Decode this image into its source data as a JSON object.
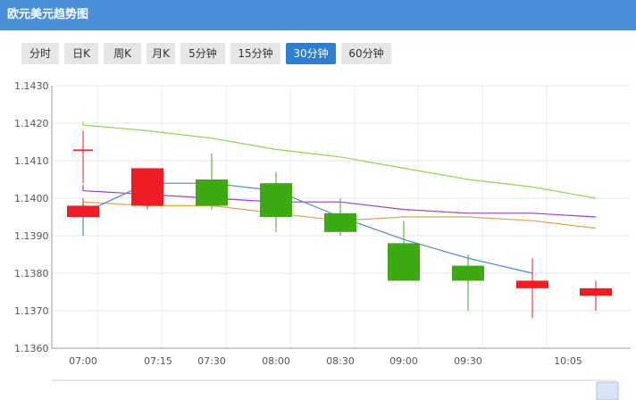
{
  "header": {
    "title": "欧元美元趋势图"
  },
  "tabs": [
    {
      "label": "分时",
      "active": false
    },
    {
      "label": "日K",
      "active": false
    },
    {
      "label": "周K",
      "active": false
    },
    {
      "label": "月K",
      "active": false
    },
    {
      "label": "5分钟",
      "active": false
    },
    {
      "label": "15分钟",
      "active": false
    },
    {
      "label": "30分钟",
      "active": true
    },
    {
      "label": "60分钟",
      "active": false
    }
  ],
  "colors": {
    "header": "#4a90d9",
    "up": "#ee1c25",
    "down": "#3daa14",
    "ma_blue": "#4a86d8",
    "ma_green": "#8fd44a",
    "ma_purple": "#9a3ed0",
    "ma_orange": "#e0a04a"
  },
  "chart_data": {
    "type": "candlestick",
    "ylim": [
      1.136,
      1.143
    ],
    "y_ticks": [
      "1.1430",
      "1.1420",
      "1.1410",
      "1.1400",
      "1.1390",
      "1.1380",
      "1.1370",
      "1.1360"
    ],
    "x_labels": [
      "07:00",
      "07:15",
      "07:30",
      "08:00",
      "08:30",
      "09:00",
      "09:30",
      "10:05"
    ],
    "candles": [
      {
        "open": 1.1398,
        "close": 1.1395,
        "high": 1.14,
        "low": 1.1395
      },
      {
        "open": 1.1413,
        "close": 1.1413,
        "high": 1.1418,
        "low": 1.1404
      },
      {
        "open": 1.1408,
        "close": 1.1398,
        "high": 1.1408,
        "low": 1.1397
      },
      {
        "open": 1.1405,
        "close": 1.1398,
        "high": 1.1412,
        "low": 1.1397
      },
      {
        "open": 1.1404,
        "close": 1.1395,
        "high": 1.1407,
        "low": 1.1391
      },
      {
        "open": 1.1396,
        "close": 1.1391,
        "high": 1.14,
        "low": 1.139
      },
      {
        "open": 1.1388,
        "close": 1.1378,
        "high": 1.1394,
        "low": 1.1378
      },
      {
        "open": 1.1382,
        "close": 1.1378,
        "high": 1.1385,
        "low": 1.137
      },
      {
        "open": 1.1378,
        "close": 1.1376,
        "high": 1.1384,
        "low": 1.1368
      },
      {
        "open": 1.1376,
        "close": 1.1374,
        "high": 1.1378,
        "low": 1.137
      }
    ],
    "ma_series": [
      {
        "color": "ma_green",
        "values": [
          1.14205,
          1.14195,
          1.1418,
          1.1416,
          1.1413,
          1.1411,
          1.1408,
          1.1405,
          1.1403,
          1.14
        ]
      },
      {
        "color": "ma_purple",
        "values": [
          1.14035,
          1.1402,
          1.1401,
          1.14,
          1.1399,
          1.1399,
          1.1397,
          1.1396,
          1.1396,
          1.1395
        ]
      },
      {
        "color": "ma_orange",
        "values": [
          1.1398,
          1.1399,
          1.1398,
          1.1398,
          1.1396,
          1.1394,
          1.1395,
          1.1395,
          1.1394,
          1.1392
        ]
      },
      {
        "color": "ma_blue",
        "values": [
          1.139,
          1.1396,
          1.1404,
          1.1404,
          1.1402,
          1.1395,
          1.1389,
          1.1384,
          1.138,
          null
        ]
      }
    ]
  }
}
